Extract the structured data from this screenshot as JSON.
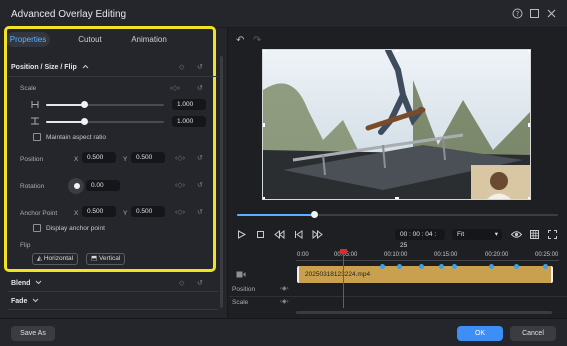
{
  "window": {
    "title": "Advanced Overlay Editing"
  },
  "tabs": [
    {
      "label": "Properties"
    },
    {
      "label": "Cutout"
    },
    {
      "label": "Animation"
    }
  ],
  "properties": {
    "section_title": "Position / Size / Flip",
    "scale": {
      "label": "Scale",
      "width_value": "1.000",
      "height_value": "1.000",
      "width_level": 0.33,
      "height_level": 0.33
    },
    "maintain_aspect_ratio": "Maintain aspect ratio",
    "position": {
      "label": "Position",
      "x_label": "X",
      "x_value": "0.500",
      "y_label": "Y",
      "y_value": "0.500"
    },
    "rotation": {
      "label": "Rotation",
      "value": "0.00"
    },
    "anchor_point": {
      "label": "Anchor Point",
      "x_label": "X",
      "x_value": "0.500",
      "y_label": "Y",
      "y_value": "0.500"
    },
    "display_anchor_point": "Display anchor point",
    "flip": {
      "label": "Flip",
      "horizontal": "Horizontal",
      "vertical": "Vertical"
    },
    "blend": "Blend",
    "fade": "Fade"
  },
  "playback": {
    "timecode": "00 : 00 : 04 : 25",
    "fit": "Fit",
    "progress": 0.24
  },
  "timeline": {
    "ticks": [
      "0:00",
      "00:05:00",
      "00:10:00",
      "00:15:00",
      "00:20:00",
      "00:25:00"
    ],
    "clip_name": "20250318123224.mp4",
    "rows": [
      "Position",
      "Scale"
    ]
  },
  "footer": {
    "save_as": "Save As",
    "ok": "OK",
    "cancel": "Cancel"
  },
  "colors": {
    "highlight": "#f1e224",
    "accent": "#5ab0ff",
    "clip": "#c9a14e",
    "playhead": "#e02a2a",
    "ok": "#3d8ef5"
  }
}
